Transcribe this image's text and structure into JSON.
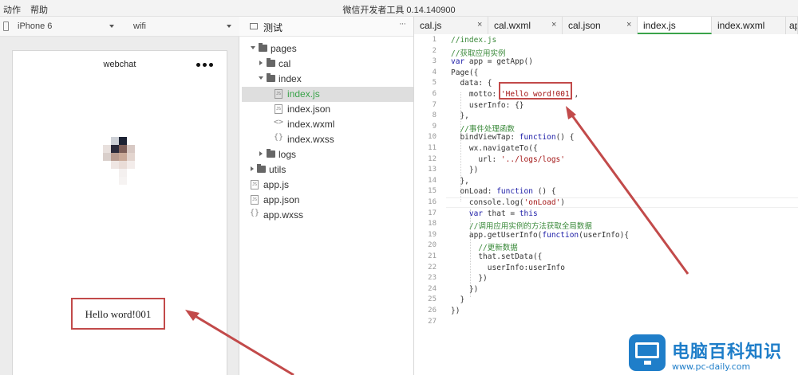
{
  "menubar": {
    "items": [
      "动作",
      "帮助"
    ],
    "app_title": "微信开发者工具 0.14.140900"
  },
  "device_toolbar": {
    "device": "iPhone 6",
    "network": "wifi"
  },
  "simulator": {
    "nav_title": "webchat",
    "menu_icon": "three-dots-icon",
    "motto": "Hello word!001"
  },
  "file_tree": {
    "project": "测试",
    "more_icon": "···",
    "items": [
      {
        "label": "pages",
        "type": "folder",
        "expanded": true
      },
      {
        "label": "cal",
        "type": "folder",
        "expanded": false
      },
      {
        "label": "index",
        "type": "folder",
        "expanded": true
      },
      {
        "label": "index.js",
        "type": "js",
        "selected": true
      },
      {
        "label": "index.json",
        "type": "json"
      },
      {
        "label": "index.wxml",
        "type": "wxml"
      },
      {
        "label": "index.wxss",
        "type": "wxss"
      },
      {
        "label": "logs",
        "type": "folder",
        "expanded": false
      },
      {
        "label": "utils",
        "type": "folder",
        "expanded": false
      },
      {
        "label": "app.js",
        "type": "js"
      },
      {
        "label": "app.json",
        "type": "json"
      },
      {
        "label": "app.wxss",
        "type": "wxss"
      }
    ],
    "js_badge": "JS"
  },
  "editor": {
    "tabs": [
      {
        "label": "cal.js",
        "active": false
      },
      {
        "label": "cal.wxml",
        "active": false
      },
      {
        "label": "cal.json",
        "active": false
      },
      {
        "label": "index.js",
        "active": true
      },
      {
        "label": "index.wxml",
        "active": false
      },
      {
        "label": "ap",
        "active": false
      }
    ],
    "close_glyph": "×",
    "lines": [
      "//index.js",
      "//获取应用实例",
      "var app = getApp()",
      "Page({",
      "  data: {",
      "    motto: 'Hello word!001',",
      "    userInfo: {}",
      "  },",
      "  //事件处理函数",
      "  bindViewTap: function() {",
      "    wx.navigateTo({",
      "      url: '../logs/logs'",
      "    })",
      "  },",
      "  onLoad: function () {",
      "    console.log('onLoad')",
      "    var that = this",
      "    //调用应用实例的方法获取全局数据",
      "    app.getUserInfo(function(userInfo){",
      "      //更新数据",
      "      that.setData({",
      "        userInfo:userInfo",
      "      })",
      "    })",
      "  }",
      "})",
      ""
    ]
  },
  "watermark": {
    "brand": "电脑百科知识",
    "url": "www.pc-daily.com"
  },
  "colors": {
    "accent_green": "#3aa34a",
    "annotation_red": "#c24a4a",
    "watermark_blue": "#1f7ec9"
  }
}
